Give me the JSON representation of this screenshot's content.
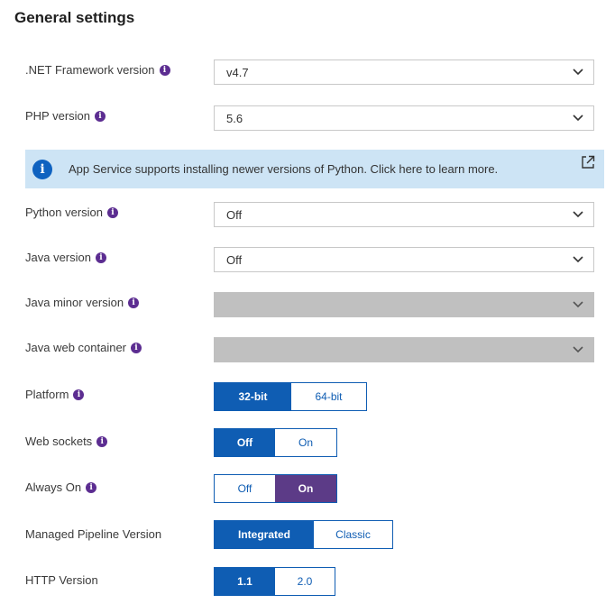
{
  "title": "General settings",
  "dotnet": {
    "label": ".NET Framework version",
    "value": "v4.7"
  },
  "php": {
    "label": "PHP version",
    "value": "5.6"
  },
  "banner": {
    "text": "App Service supports installing newer versions of Python. Click here to learn more."
  },
  "python": {
    "label": "Python version",
    "value": "Off"
  },
  "java": {
    "label": "Java version",
    "value": "Off"
  },
  "java_minor": {
    "label": "Java minor version",
    "value": ""
  },
  "java_container": {
    "label": "Java web container",
    "value": ""
  },
  "platform": {
    "label": "Platform",
    "options": [
      "32-bit",
      "64-bit"
    ],
    "selected": "32-bit"
  },
  "web_sockets": {
    "label": "Web sockets",
    "options": [
      "Off",
      "On"
    ],
    "selected": "Off"
  },
  "always_on": {
    "label": "Always On",
    "options": [
      "Off",
      "On"
    ],
    "selected": "On"
  },
  "pipeline": {
    "label": "Managed Pipeline Version",
    "options": [
      "Integrated",
      "Classic"
    ],
    "selected": "Integrated"
  },
  "http": {
    "label": "HTTP Version",
    "options": [
      "1.1",
      "2.0"
    ],
    "selected": "1.1"
  },
  "colors": {
    "accent": "#0f5db3",
    "always_on_selected": "#5c3b87",
    "info": "#5c2d91",
    "banner_bg": "#cde4f5"
  }
}
